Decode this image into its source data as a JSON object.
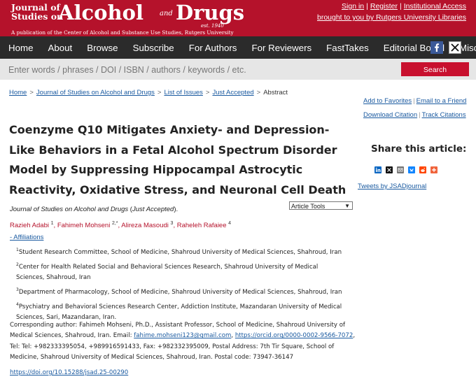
{
  "masthead": {
    "logo": {
      "journal_of": "Journal of",
      "studies_on": "Studies on",
      "alcohol": "Alcohol",
      "and": "and",
      "drugs": "Drugs",
      "est": "est. 1940",
      "publication": "A publication of the Center of Alcohol and Substance Use Studies, Rutgers University"
    },
    "sign_in": "Sign in",
    "register": "Register",
    "institutional_access": "Institutional Access",
    "sep": "|",
    "brought_by": "brought to you by Rutgers University Libraries"
  },
  "nav": {
    "items": [
      "Home",
      "About",
      "Browse",
      "Subscribe",
      "For Authors",
      "For Reviewers",
      "FastTakes",
      "Editorial Board",
      "Misc."
    ]
  },
  "search": {
    "placeholder": "Enter words / phrases / DOI / ISBN / authors / keywords / etc.",
    "button": "Search"
  },
  "breadcrumb": {
    "items": [
      "Home",
      "Journal of Studies on Alcohol and Drugs",
      "List of Issues",
      "Just Accepted"
    ],
    "current": "Abstract",
    "sep": ">"
  },
  "actions": {
    "add_favorites": "Add to Favorites",
    "email_friend": "Email to a Friend",
    "download_citation": "Download Citation",
    "track_citations": "Track Citations",
    "sep": "|"
  },
  "article": {
    "title": "Coenzyme Q10 Mitigates Anxiety- and Depression-Like Behaviors in a Fetal Alcohol Spectrum Disorder Model by Suppressing Hippocampal Astrocytic Reactivity, Oxidative Stress, and Neuronal Cell Death",
    "journal": "Journal of Studies on Alcohol and Drugs",
    "paren_open": " (",
    "status": "Just Accepted",
    "paren_close": ").",
    "tools_label": "Article Tools",
    "authors": [
      {
        "name": "Razieh Adabi",
        "sup": "1"
      },
      {
        "name": "Fahimeh Mohseni",
        "sup": "2,*"
      },
      {
        "name": "Alireza Masoudi",
        "sup": "3"
      },
      {
        "name": "Raheleh Rafaiee",
        "sup": "4"
      }
    ],
    "author_sep": ",",
    "affiliations_toggle": "- Affiliations",
    "affiliations": [
      {
        "num": "1",
        "text": "Student Research Committee, School of Medicine, Shahroud University of Medical Sciences, Shahroud, Iran"
      },
      {
        "num": "2",
        "text": "Center for Health Related Social and Behavioral Sciences Research, Shahroud University of Medical Sciences, Shahroud, Iran"
      },
      {
        "num": "3",
        "text": "Department of Pharmacology, School of Medicine, Shahroud University of Medical Sciences, Shahroud, Iran"
      },
      {
        "num": "4",
        "text": "Psychiatry and Behavioral Sciences Research Center, Addiction Institute, Mazandaran University of Medical Sciences, Sari, Mazandaran, Iran."
      }
    ],
    "corresponding": {
      "prefix": "Corresponding author: Fahimeh Mohseni, Ph.D., Assistant Professor, School of Medicine, Shahroud University of Medical Sciences, Shahroud, Iran. Email: ",
      "email": "fahime.mohseni123@gmail.com",
      "mid": ", ",
      "orcid": "https://orcid.org/0000-0002-9566-7072",
      "suffix": ", Tel: Tel: +982333395054, +989916591433, Fax: +982332395009, Postal Address: 7th Tir Square, School of Medicine, Shahroud University of Medical Sciences, Shahroud, Iran. Postal code: 73947-36147"
    },
    "doi": "https://doi.org/10.15288/jsad.25-00290"
  },
  "share": {
    "title": "Share this article:",
    "icons": [
      "linkedin-icon",
      "x-icon",
      "email-icon",
      "bluesky-icon",
      "reddit-icon",
      "more-icon"
    ],
    "tweets": "Tweets by JSADjournal"
  },
  "colors": {
    "brand_red": "#b5122b",
    "nav_bg": "#2b2b2b",
    "search_bg": "#e6e6e6",
    "button_red": "#c8102e",
    "link_blue": "#1a5aa0"
  }
}
